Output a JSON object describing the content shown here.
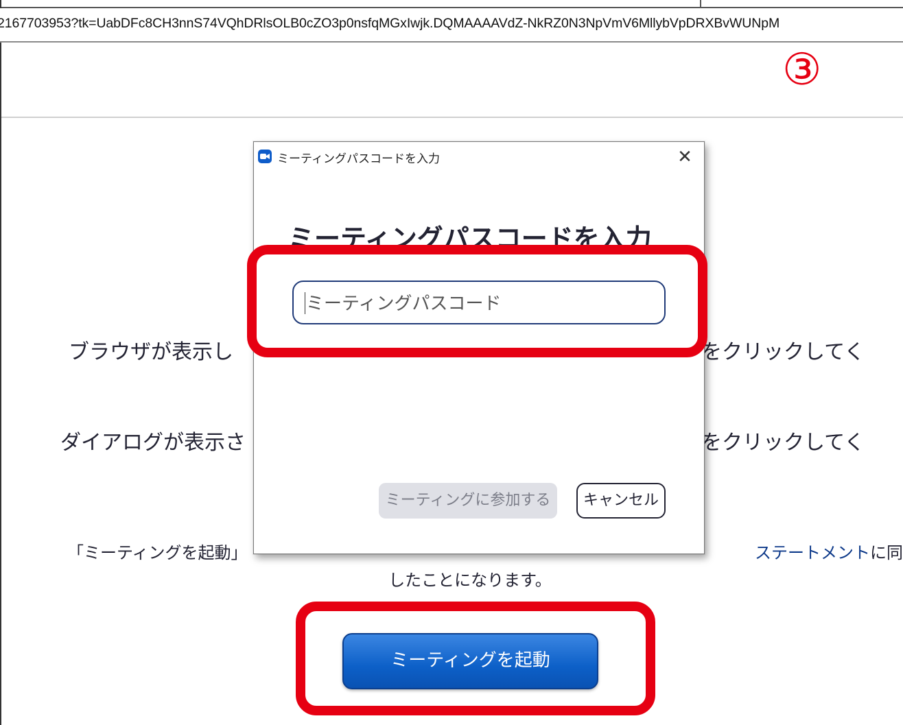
{
  "browser": {
    "url": "2167703953?tk=UabDFc8CH3nnS74VQhDRlsOLB0cZO3p0nsfqMGxIwjk.DQMAAAAVdZ-NkRZ0N3NpVmV6MllybVpDRXBvWUNpM"
  },
  "annotation": {
    "step_number": "③",
    "highlight_color": "#e60012"
  },
  "page": {
    "instruction_1_start": "ブラウザが表示し",
    "instruction_1_end": "をクリックしてく",
    "instruction_2_start": "ダイアログが表示さ",
    "instruction_2_end": "をクリックしてく",
    "terms_line1_a": "「ミーティングを起動」",
    "terms_line1_link": "ステートメント",
    "terms_line1_b": "に同意",
    "terms_line2": "したことになります。",
    "launch_button": "ミーティングを起動"
  },
  "dialog": {
    "window_title": "ミーティングパスコードを入力",
    "heading": "ミーティングパスコードを入力",
    "passcode_placeholder": "ミーティングパスコード",
    "join_button": "ミーティングに参加する",
    "cancel_button": "キャンセル",
    "icons": {
      "app": "zoom-camera-icon",
      "close": "close-icon"
    },
    "accent_color": "#0e5cc9"
  }
}
